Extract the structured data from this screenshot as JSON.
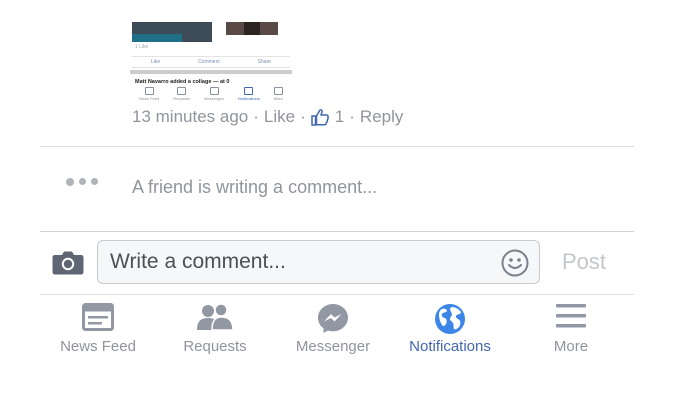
{
  "embedded_screenshot": {
    "likes": "1 Like",
    "actions": [
      "Like",
      "Comment",
      "Share"
    ],
    "notification": "Matt Navarro added a collage — at 0",
    "tabs": [
      "News Feed",
      "Requests",
      "Messenger",
      "Notifications",
      "More"
    ]
  },
  "comment": {
    "time": "13 minutes ago",
    "like_label": "Like",
    "like_count": "1",
    "reply_label": "Reply",
    "separator": "·"
  },
  "typing_indicator": {
    "text": "A friend is writing a comment..."
  },
  "composer": {
    "placeholder": "Write a comment...",
    "post_label": "Post"
  },
  "tabbar": {
    "active": "Notifications",
    "tabs": [
      {
        "label": "News Feed",
        "icon": "news-feed-icon"
      },
      {
        "label": "Requests",
        "icon": "friend-requests-icon"
      },
      {
        "label": "Messenger",
        "icon": "messenger-icon"
      },
      {
        "label": "Notifications",
        "icon": "globe-icon"
      },
      {
        "label": "More",
        "icon": "menu-icon"
      }
    ]
  },
  "colors": {
    "accent": "#4267b2",
    "muted_text": "#90949c",
    "divider": "#dddfe2",
    "icon_gray": "#9197a3",
    "globe_blue": "#3b86e6"
  }
}
